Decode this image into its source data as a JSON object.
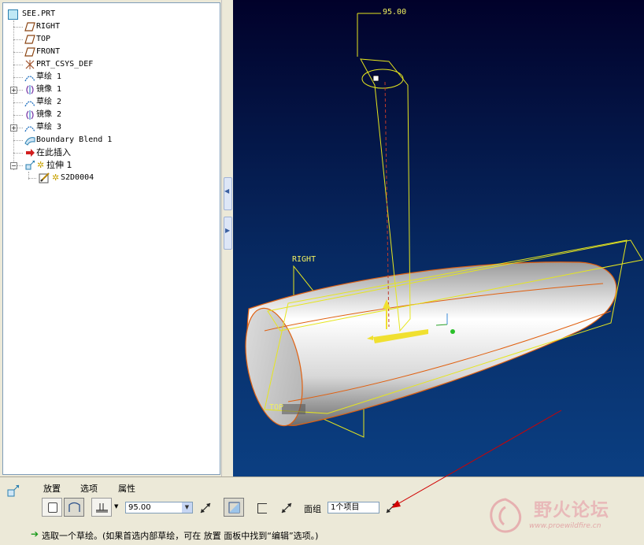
{
  "model_tree": {
    "root": "SEE.PRT",
    "items": [
      {
        "label": "RIGHT",
        "icon": "datum-plane-icon",
        "expandable": false
      },
      {
        "label": "TOP",
        "icon": "datum-plane-icon",
        "expandable": false
      },
      {
        "label": "FRONT",
        "icon": "datum-plane-icon",
        "expandable": false
      },
      {
        "label": "PRT_CSYS_DEF",
        "icon": "csys-icon",
        "expandable": false
      },
      {
        "label": "草绘 1",
        "icon": "sketch-icon",
        "expandable": false
      },
      {
        "label": "镜像 1",
        "icon": "mirror-icon",
        "expandable": true
      },
      {
        "label": "草绘 2",
        "icon": "sketch-icon",
        "expandable": false
      },
      {
        "label": "镜像 2",
        "icon": "mirror-icon",
        "expandable": false
      },
      {
        "label": "草绘 3",
        "icon": "sketch-icon",
        "expandable": true
      },
      {
        "label": "Boundary Blend 1",
        "icon": "boundary-blend-icon",
        "expandable": false
      },
      {
        "label": "在此插入",
        "icon": "insert-here-arrow-icon",
        "expandable": false
      },
      {
        "label": "拉伸 1",
        "icon": "extrude-icon",
        "expandable": true,
        "expanded": true
      },
      {
        "label": "S2D0004",
        "icon": "section-sketch-icon",
        "child": true
      }
    ]
  },
  "viewport": {
    "dimension_value": "95.00",
    "datum_labels": {
      "right": "RIGHT",
      "top": "TOP"
    }
  },
  "dashboard": {
    "tabs": [
      "放置",
      "选项",
      "属性"
    ],
    "depth_value": "95.00",
    "quilt_label": "面组",
    "quilt_value": "1个项目",
    "status_message": "选取一个草绘。(如果首选内部草绘，可在 放置 面板中找到“编辑”选项。)"
  },
  "watermark": {
    "text": "野火论坛",
    "url": "www.proewildfire.cn"
  }
}
